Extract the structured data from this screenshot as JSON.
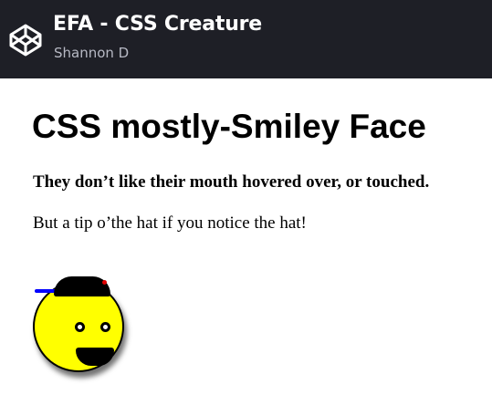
{
  "header": {
    "title": "EFA - CSS Creature",
    "author": "Shannon D",
    "logo_icon": "codepen-logo-icon",
    "background": "#1e1f26"
  },
  "main": {
    "title": "CSS mostly-Smiley Face",
    "subtitle": "They don’t like their mouth hovered over, or touched.",
    "hint": "But a tip o’the hat if you notice the hat!"
  },
  "creature": {
    "face_color": "#ffff00",
    "hat_color": "#000000",
    "hat_button_color": "#e00000",
    "brim_color": "#0000ff"
  }
}
